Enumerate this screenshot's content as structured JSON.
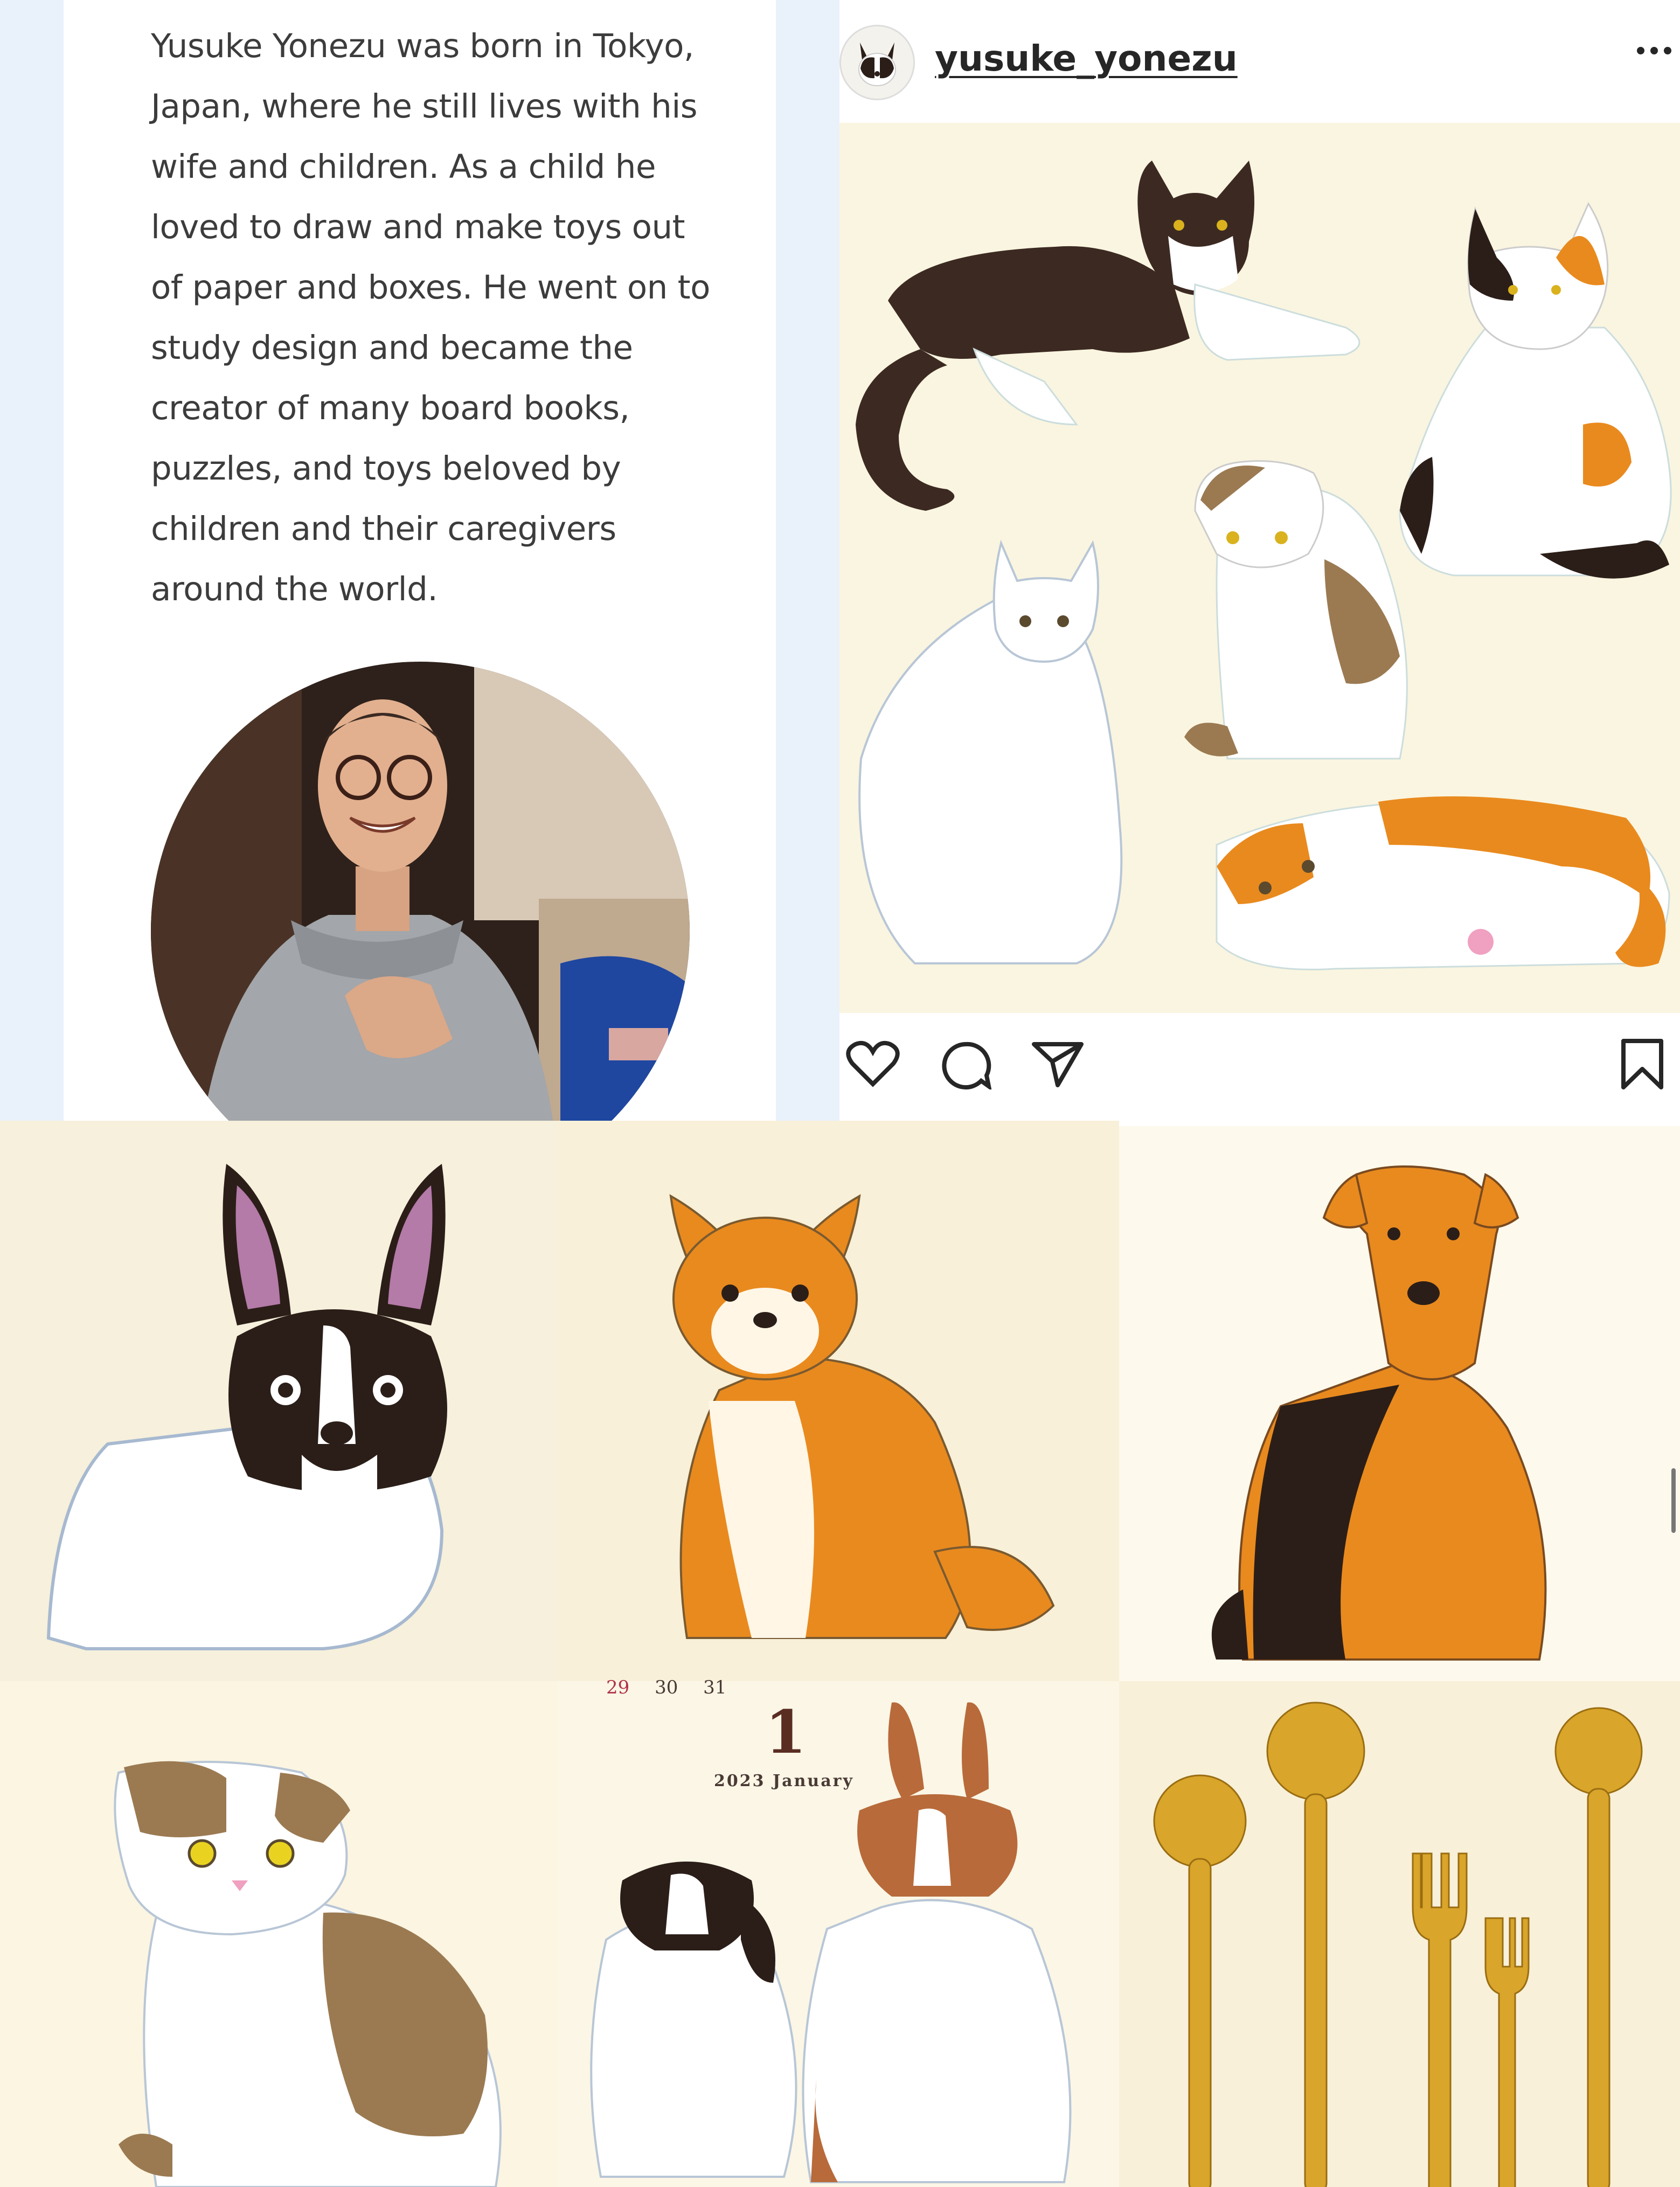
{
  "bio": {
    "lines": [
      "Yusuke Yonezu was born in Tokyo,",
      "Japan, where he still lives with his",
      "wife and children. As a child he",
      "loved to draw and make toys out",
      "of paper and boxes. He went on to",
      "study design and became the",
      "creator of many board books,",
      "puzzles, and toys beloved by",
      "children and their caregivers",
      "around the world."
    ]
  },
  "post": {
    "username": "yusuke_yonezu",
    "more_icon": "more-horizontal-icon",
    "action_icons": [
      "heart-icon",
      "comment-icon",
      "share-icon",
      "bookmark-icon"
    ]
  },
  "calendar": {
    "days": [
      "29",
      "30",
      "31"
    ],
    "big_number": "1",
    "month": "2023 January"
  },
  "colors": {
    "bio_background": "#e9f1fb",
    "text": "#3c3c3c",
    "post_image_background": "#faf5e0",
    "orange": "#e98a1e",
    "brown": "#3a2a22"
  }
}
